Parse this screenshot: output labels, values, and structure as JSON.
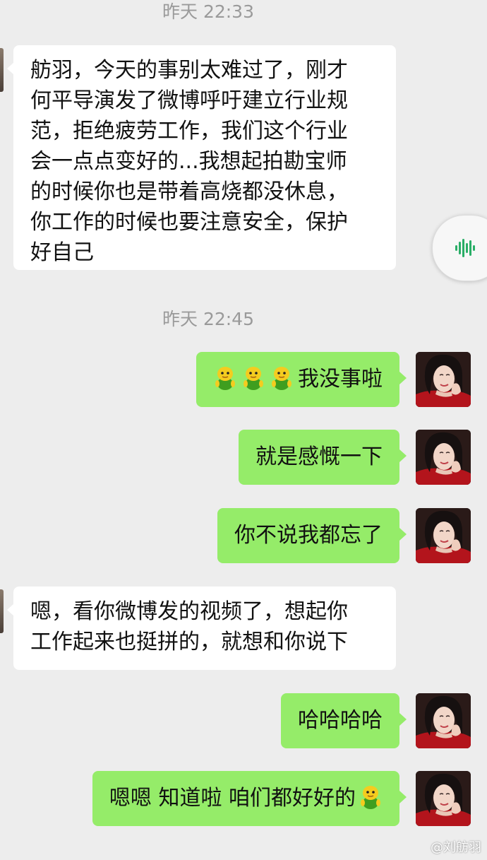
{
  "timestamps": [
    "昨天 22:33",
    "昨天 22:45"
  ],
  "messages": {
    "m1": {
      "lines": [
        "舫羽，今天的事别太难过了，刚才",
        "何平导演发了微博呼吁建立行业规",
        "范，拒绝疲劳工作，我们这个行业",
        "会一点点变好的...我想起拍勘宝师",
        "的时候你也是带着高烧都没休息，",
        "你工作的时候也要注意安全，保护",
        "好自己"
      ]
    },
    "m2": {
      "text": "我没事啦",
      "emoji": [
        "bird-emoji",
        "bird-emoji",
        "bird-emoji"
      ]
    },
    "m3": {
      "text": "就是感慨一下"
    },
    "m4": {
      "text": "你不说我都忘了"
    },
    "m5": {
      "lines": [
        "嗯，看你微博发的视频了，想起你",
        "工作起来也挺拼的，就想和你说下"
      ]
    },
    "m6": {
      "text": "哈哈哈哈"
    },
    "m7": {
      "text": "嗯嗯 知道啦 咱们都好好的",
      "emoji": [
        "bird-emoji"
      ]
    }
  },
  "watermark": "@刘舫羽",
  "colors": {
    "background": "#ededed",
    "incoming_bubble": "#ffffff",
    "outgoing_bubble": "#95ec69",
    "timestamp": "#9a9a9a",
    "voice_icon": "#2aae67"
  },
  "icons": {
    "floating_button": "voice-waveform-icon",
    "emoji": "bird-emoji"
  }
}
